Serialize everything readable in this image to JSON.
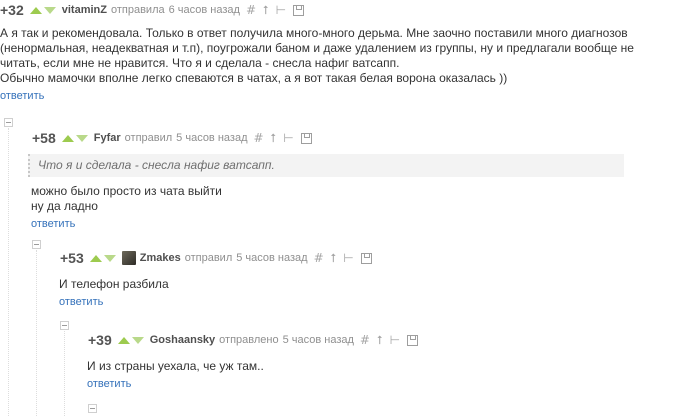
{
  "comments": [
    {
      "rating": "+32",
      "author": "vitaminZ",
      "action": "отправила",
      "time": "6 часов назад",
      "lines": [
        "А я так и рекомендовала. Только в ответ получила много-много дерьма. Мне заочно поставили много диагнозов",
        "(ненормальная, неадекватная и т.п), поугрожали баном и даже удалением из группы, ну и предлагали вообще не",
        "читать, если мне не нравится. Что я и сделала - снесла нафиг ватсапп.",
        "Обычно мамочки вполне легко спеваются в чатах, а я вот такая белая ворона оказалась ))"
      ],
      "reply": "ответить"
    },
    {
      "rating": "+58",
      "author": "Fyfar",
      "action": "отправил",
      "time": "5 часов назад",
      "quote": "Что я и сделала - снесла нафиг ватсапп.",
      "lines": [
        "можно было просто из чата выйти",
        "ну да ладно"
      ],
      "reply": "ответить"
    },
    {
      "rating": "+53",
      "author": "Zmakes",
      "action": "отправил",
      "time": "5 часов назад",
      "lines": [
        "И телефон разбила"
      ],
      "reply": "ответить"
    },
    {
      "rating": "+39",
      "author": "Goshaansky",
      "action": "отправлено",
      "time": "5 часов назад",
      "lines": [
        "И из страны уехала, че уж там.."
      ],
      "reply": "ответить"
    }
  ],
  "icons": {
    "hash": "#",
    "up": "⭡",
    "branch": "⊢"
  },
  "colors": {
    "vote_up": "#9dcb4f",
    "reply_link": "#3471ba"
  }
}
